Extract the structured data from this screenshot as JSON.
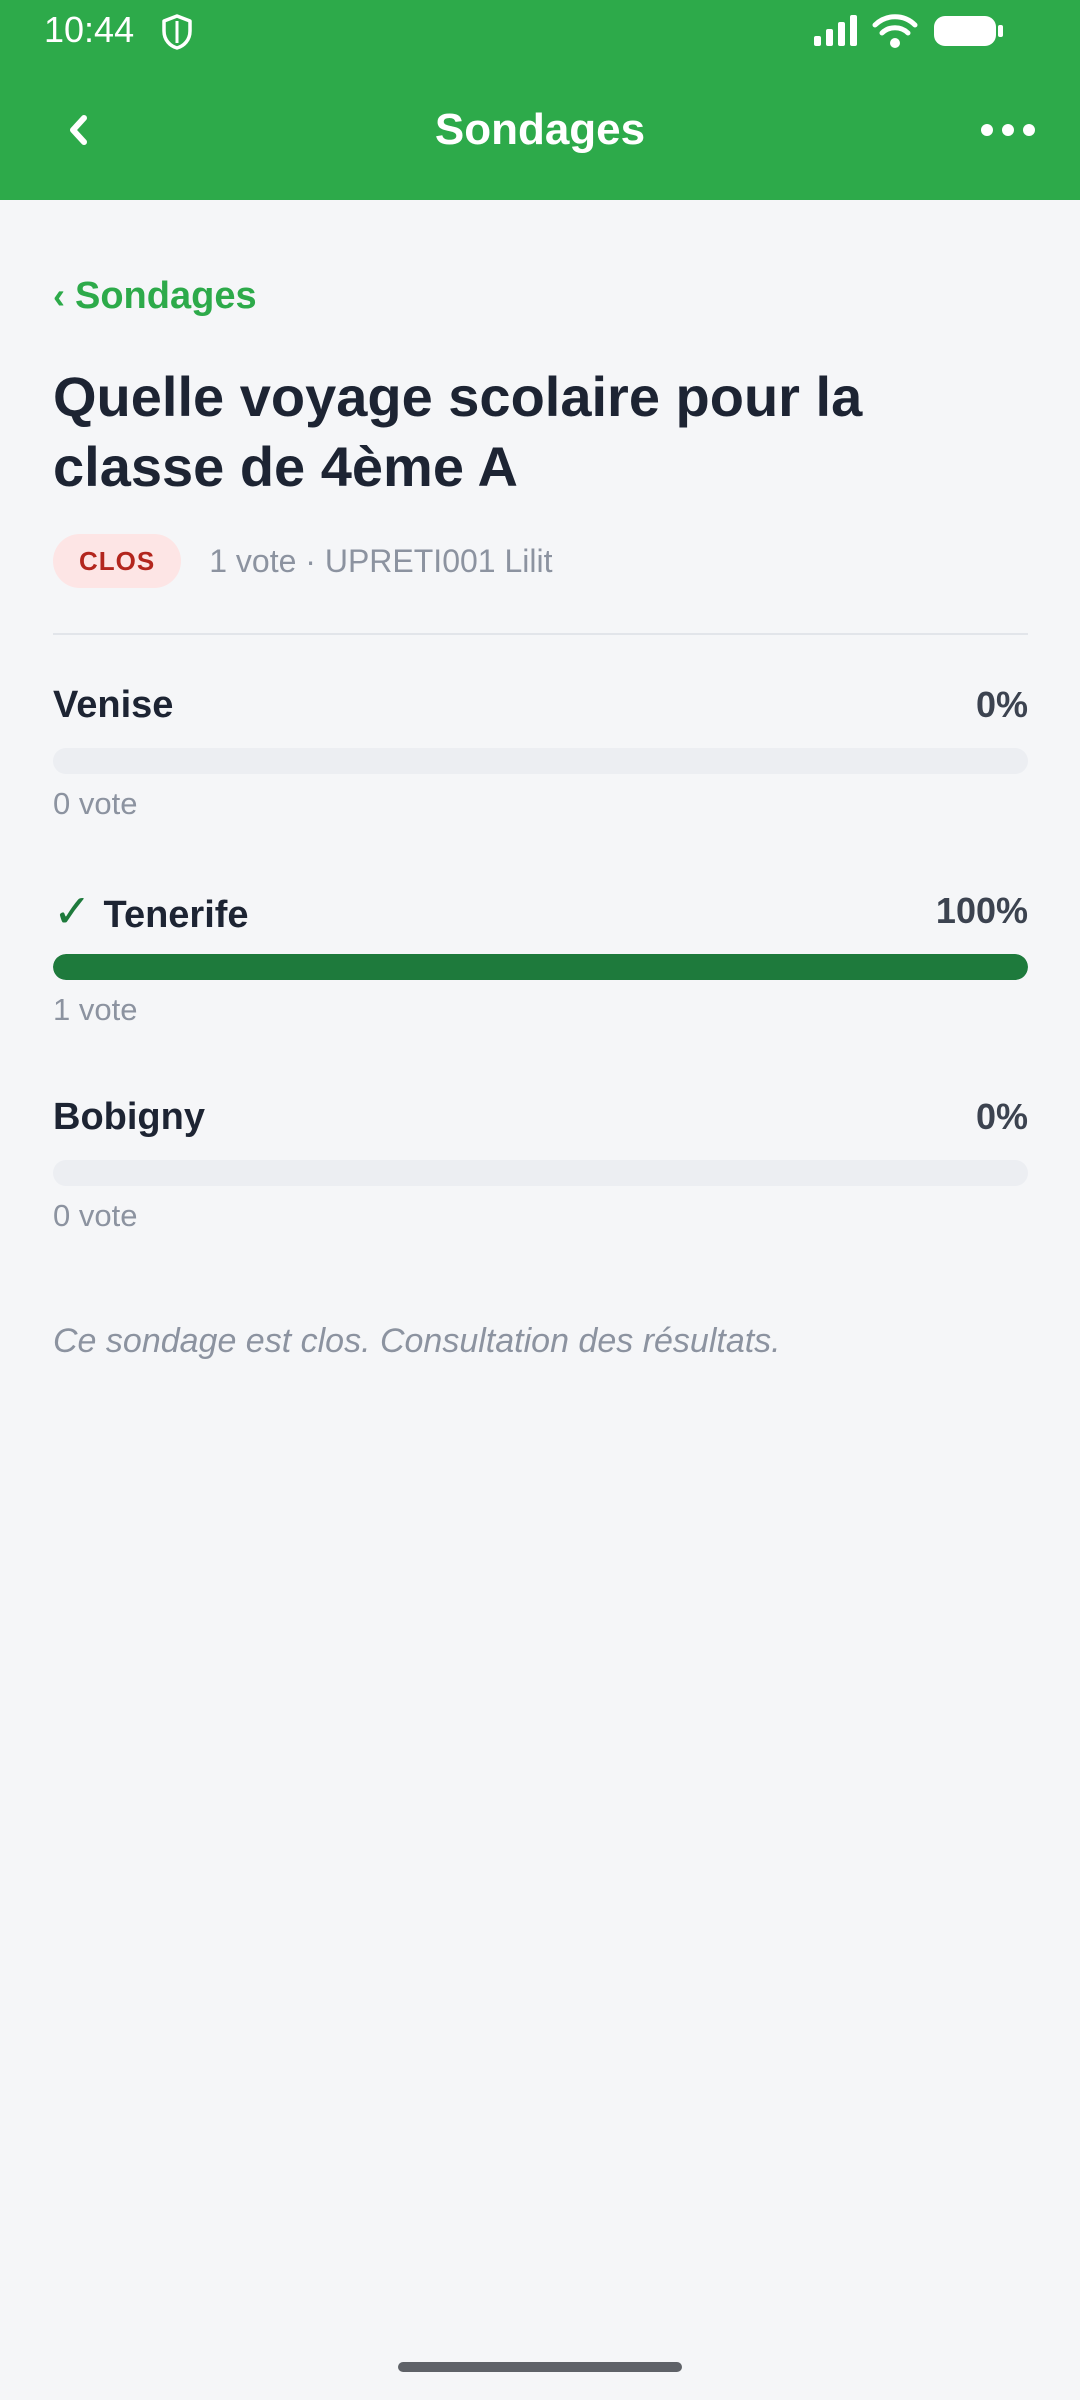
{
  "status_bar": {
    "time": "10:44",
    "icons": [
      "shield-icon",
      "signal-icon",
      "wifi-icon",
      "battery-icon"
    ]
  },
  "app_bar": {
    "title": "Sondages",
    "back_icon": "chevron-left-icon",
    "menu_icon": "more-horizontal-icon",
    "color": "#2daa4a"
  },
  "breadcrumb": {
    "chevron": "‹",
    "label": "Sondages"
  },
  "poll": {
    "title": "Quelle voyage scolaire pour la classe de 4ème A",
    "status_badge": "CLOS",
    "meta": "1 vote · UPRETI001 Lilit",
    "options": [
      {
        "label": "Venise",
        "percent_label": "0%",
        "percent": 0,
        "votes": "0 vote",
        "winner": false
      },
      {
        "label": "Tenerife",
        "percent_label": "100%",
        "percent": 100,
        "votes": "1 vote",
        "winner": true,
        "check": "✓"
      },
      {
        "label": "Bobigny",
        "percent_label": "0%",
        "percent": 0,
        "votes": "0 vote",
        "winner": false
      }
    ],
    "closed_note": "Ce sondage est clos. Consultation des résultats."
  },
  "colors": {
    "accent": "#2daa4a",
    "winner_bar": "#1e7a3c",
    "badge_bg": "#fde5e5",
    "badge_text": "#b3261e"
  }
}
